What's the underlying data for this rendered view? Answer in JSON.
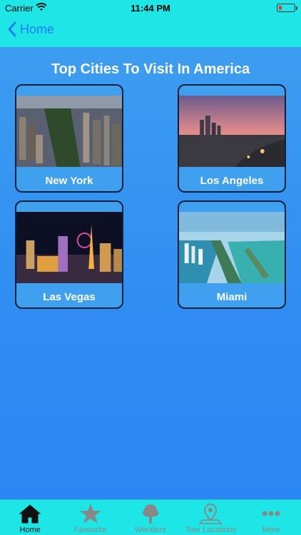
{
  "status": {
    "carrier": "Carrier",
    "time": "11:44 PM"
  },
  "nav": {
    "back_label": "Home"
  },
  "page": {
    "title": "Top Cities To Visit In America"
  },
  "cities": [
    {
      "name": "New York"
    },
    {
      "name": "Los Angeles"
    },
    {
      "name": "Las Vegas"
    },
    {
      "name": "Miami"
    }
  ],
  "tabs": [
    {
      "label": "Home",
      "icon": "home-icon",
      "active": true
    },
    {
      "label": "Favourite",
      "icon": "star-icon",
      "active": false
    },
    {
      "label": "Wonders",
      "icon": "tree-icon",
      "active": false
    },
    {
      "label": "Tour Locations",
      "icon": "map-pin-icon",
      "active": false
    },
    {
      "label": "More",
      "icon": "more-icon",
      "active": false
    }
  ],
  "colors": {
    "bar": "#1fe6e6",
    "accent": "#1a7ff0",
    "background": "#2f8cf2"
  }
}
